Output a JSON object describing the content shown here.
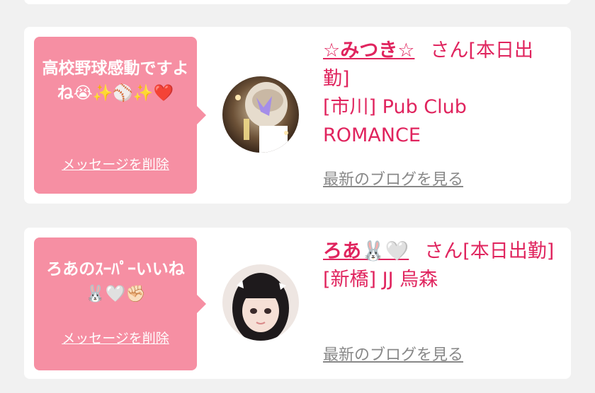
{
  "messages": [
    {
      "bubble_text": "高校野球感動ですよね😭✨⚾✨❤️",
      "delete_label": "メッセージを削除",
      "name": "☆みつき☆",
      "suffix": "さん[本日出勤]",
      "shop": "[市川] Pub Club ROMANCE",
      "blog_label": "最新のブログを見る"
    },
    {
      "bubble_text": "ろあのｽｰﾊﾟｰいいね🐰🤍✊🏻",
      "delete_label": "メッセージを削除",
      "name": "ろあ🐰🤍",
      "suffix": "さん[本日出勤]",
      "shop": "[新橋] JJ 烏森",
      "blog_label": "最新のブログを見る"
    }
  ],
  "colors": {
    "background": "#f1f1f1",
    "card": "#ffffff",
    "bubble": "#f68fa3",
    "accent_pink": "#e0245e",
    "link_gray": "#888888"
  }
}
